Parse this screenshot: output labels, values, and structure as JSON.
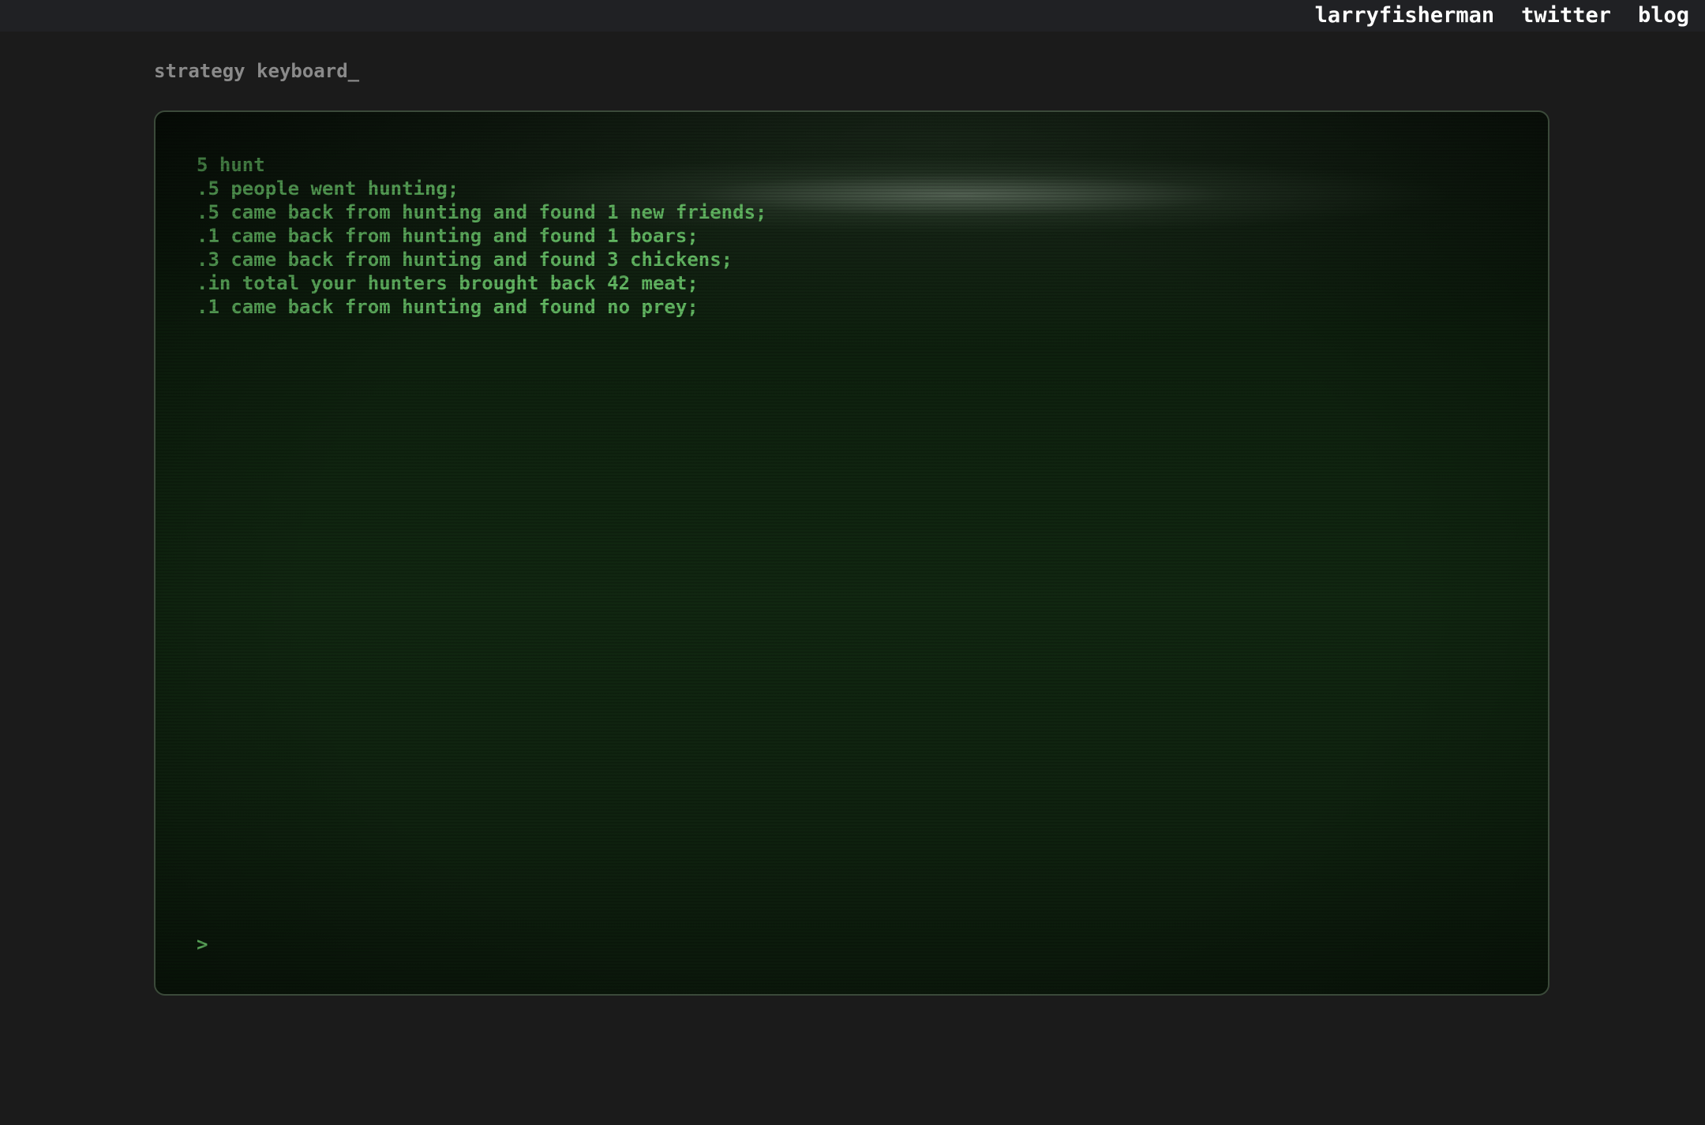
{
  "nav": {
    "links": [
      "larryfisherman",
      "twitter",
      "blog"
    ]
  },
  "site": {
    "title": "strategy keyboard_"
  },
  "terminal": {
    "lines": [
      "5 hunt",
      ".5 people went hunting;",
      ".5 came back from hunting and found 1 new friends;",
      ".1 came back from hunting and found 1 boars;",
      ".3 came back from hunting and found 3 chickens;",
      ".in total your hunters brought back 42 meat;",
      ".1 came back from hunting and found no prey;"
    ],
    "prompt_symbol": ">",
    "input_value": ""
  },
  "colors": {
    "page_background": "#1b1b1b",
    "topbar_background": "#202124",
    "terminal_text": "#63b963",
    "terminal_border": "#3b4a3a"
  }
}
